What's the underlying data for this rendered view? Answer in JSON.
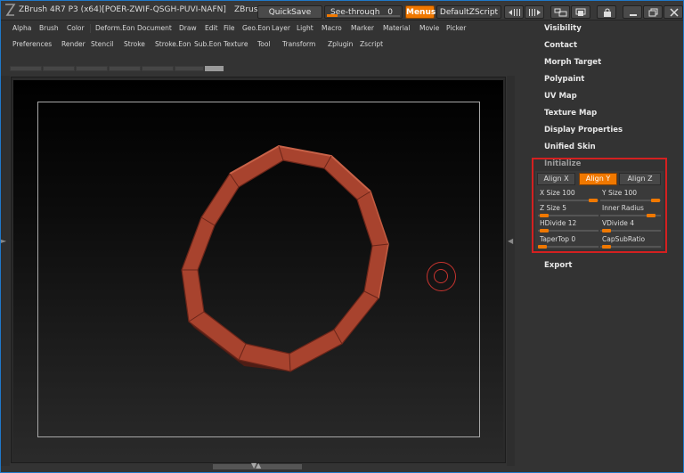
{
  "titlebar": {
    "title": "ZBrush 4R7 P3 (x64)[POER-ZWIF-QSGH-PUVI-NAFN]",
    "zbrush_label": "ZBrus",
    "quicksave": "QuickSave",
    "seethrough_label": "See-through",
    "seethrough_value": "0",
    "seethrough_level": 0,
    "menus": "Menus",
    "defaultzscript": "DefaultZScript",
    "icons": [
      "pane-left-icon",
      "pane-right-icon",
      "layout-icon",
      "layout-alt-icon",
      "lock-icon",
      "minimize-icon",
      "restore-icon",
      "close-icon"
    ]
  },
  "menus": {
    "row1": [
      "Alpha",
      "Brush",
      "Color",
      "Deform.Eon",
      "Document",
      "Draw",
      "Edit",
      "File",
      "Geo.Eon",
      "Layer",
      "Light",
      "Macro",
      "Marker",
      "Material",
      "Movie",
      "Picker"
    ],
    "row2": [
      "Preferences",
      "Render",
      "Stencil",
      "Stroke",
      "Stroke.Eon",
      "Sub.Eon",
      "Texture",
      "Tool",
      "Transform",
      "Zplugin",
      "Zscript"
    ]
  },
  "palette": {
    "items_top": [
      "Visibility",
      "Contact",
      "Morph Target",
      "Polypaint",
      "UV Map",
      "Texture Map",
      "Display Properties",
      "Unified Skin"
    ],
    "initialize": {
      "title": "Initialize",
      "align_x": "Align X",
      "align_y": "Align Y",
      "align_z": "Align Z",
      "active_align": "Align Y",
      "x_size": "X Size 100",
      "y_size": "Y Size 100",
      "z_size": "Z Size 5",
      "inner_radius": "Inner Radius",
      "hdivide": "HDivide 12",
      "vdivide": "VDivide 4",
      "tapertop": "TaperTop 0",
      "capsubratio": "CapSubRatio",
      "highlight_color": "#d42020"
    },
    "export": "Export"
  },
  "colors": {
    "accent": "#f07800",
    "ring": "#a9432f",
    "cursor": "#c8342f",
    "frame": "#1f78c8"
  }
}
